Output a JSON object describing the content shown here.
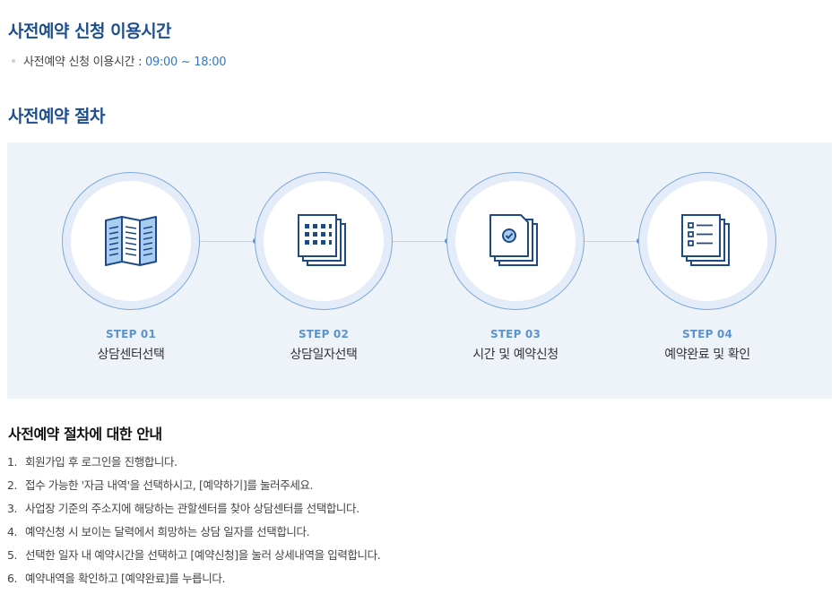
{
  "section_hours": {
    "title": "사전예약 신청 이용시간",
    "item_label": "사전예약 신청 이용시간 : ",
    "item_time": "09:00 ~ 18:00"
  },
  "section_steps": {
    "title": "사전예약 절차",
    "steps": [
      {
        "num": "STEP 01",
        "label": "상담센터선택",
        "icon": "open-book-icon"
      },
      {
        "num": "STEP 02",
        "label": "상담일자선택",
        "icon": "calendar-grid-icon"
      },
      {
        "num": "STEP 03",
        "label": "시간 및 예약신청",
        "icon": "document-check-icon"
      },
      {
        "num": "STEP 04",
        "label": "예약완료 및 확인",
        "icon": "checklist-icon"
      }
    ]
  },
  "guide": {
    "title": "사전예약 절차에 대한 안내",
    "items": [
      {
        "num": "1.",
        "text": "회원가입 후 로그인을 진행합니다."
      },
      {
        "num": "2.",
        "text": "접수 가능한 '자금 내역'을 선택하시고, [예약하기]를 눌러주세요."
      },
      {
        "num": "3.",
        "text": "사업장 기준의 주소지에 해당하는 관할센터를 찾아 상담센터를 선택합니다."
      },
      {
        "num": "4.",
        "text": "예약신청 시 보이는 달력에서 희망하는 상담 일자를 선택합니다."
      },
      {
        "num": "5.",
        "text": "선택한 일자 내 예약시간을 선택하고 [예약신청]을 눌러 상세내역을 입력합니다."
      },
      {
        "num": "6.",
        "text": "예약내역을 확인하고 [예약완료]를 누릅니다."
      }
    ]
  },
  "colors": {
    "heading": "#1d4e8e",
    "accent": "#3a76c0",
    "panel_bg": "#eef3fa",
    "icon_stroke": "#1d4a86",
    "icon_fill": "#a8cdf0"
  }
}
